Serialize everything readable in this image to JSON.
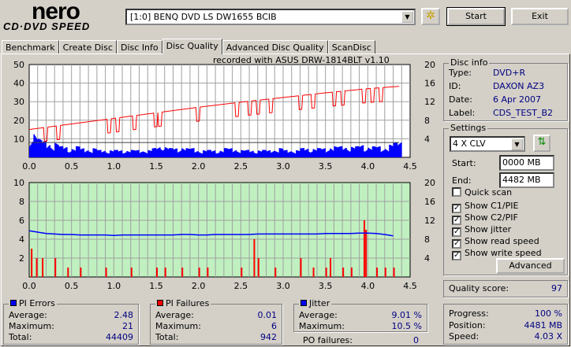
{
  "app": {
    "logo_top": "nero",
    "logo_bottom": "CD·DVD SPEED"
  },
  "toolbar": {
    "drive": "[1:0]  BENQ DVD LS DW1655 BCIB",
    "start": "Start",
    "exit": "Exit"
  },
  "tabs": [
    "Benchmark",
    "Create Disc",
    "Disc Info",
    "Disc Quality",
    "Advanced Disc Quality",
    "ScanDisc"
  ],
  "recorded_with": "recorded with ASUS    DRW-1814BLT      v1.10",
  "disc_info": {
    "title": "Disc info",
    "type_label": "Type:",
    "type": "DVD+R",
    "id_label": "ID:",
    "id": "DAXON AZ3",
    "date_label": "Date:",
    "date": "6 Apr 2007",
    "label_label": "Label:",
    "label": "CDS_TEST_B2"
  },
  "settings": {
    "title": "Settings",
    "speed": "4 X CLV",
    "start_label": "Start:",
    "start": "0000 MB",
    "end_label": "End:",
    "end": "4482 MB",
    "quick_scan": "Quick scan",
    "show_c1": "Show C1/PIE",
    "show_c2": "Show C2/PIF",
    "show_jitter": "Show jitter",
    "show_read": "Show read speed",
    "show_write": "Show write speed",
    "advanced": "Advanced"
  },
  "quality": {
    "label": "Quality score:",
    "value": "97"
  },
  "progress": {
    "progress_label": "Progress:",
    "progress": "100 %",
    "position_label": "Position:",
    "position": "4481 MB",
    "speed_label": "Speed:",
    "speed": "4.03 X"
  },
  "pi_errors": {
    "title": "PI Errors",
    "avg_label": "Average:",
    "avg": "2.48",
    "max_label": "Maximum:",
    "max": "21",
    "total_label": "Total:",
    "total": "44409"
  },
  "pi_failures": {
    "title": "PI Failures",
    "avg_label": "Average:",
    "avg": "0.01",
    "max_label": "Maximum:",
    "max": "6",
    "total_label": "Total:",
    "total": "942"
  },
  "jitter": {
    "title": "Jitter",
    "avg_label": "Average:",
    "avg": "9.01 %",
    "max_label": "Maximum:",
    "max": "10.5 %",
    "po_label": "PO failures:",
    "po": "0"
  },
  "colors": {
    "pie": "#0000ff",
    "pif": "#ff0000",
    "speed": "#ff0000",
    "jitter": "#0000ff",
    "green": "#c0f0c0"
  },
  "chart_data": [
    {
      "type": "bar",
      "title": "PI Errors / Read speed",
      "xlim": [
        0,
        4.5
      ],
      "ylim": [
        0,
        50
      ],
      "y2lim": [
        0,
        20
      ],
      "x_ticks": [
        "0.0",
        "0.5",
        "1.0",
        "1.5",
        "2.0",
        "2.5",
        "3.0",
        "3.5",
        "4.0",
        "4.5"
      ],
      "y_ticks": [
        "10",
        "20",
        "30",
        "40",
        "50"
      ],
      "y2_ticks": [
        "4",
        "8",
        "12",
        "16",
        "20"
      ],
      "pie_step": 0.05,
      "pie": [
        12,
        15,
        10,
        9,
        8,
        7,
        8,
        6,
        6,
        5,
        5,
        6,
        5,
        5,
        4,
        5,
        4,
        4,
        4,
        4,
        4,
        4,
        4,
        4,
        4,
        4,
        4,
        4,
        4,
        5,
        6,
        7,
        6,
        5,
        5,
        5,
        6,
        5,
        5,
        4,
        4,
        4,
        4,
        4,
        4,
        4,
        5,
        5,
        5,
        4,
        4,
        4,
        4,
        4,
        4,
        4,
        4,
        5,
        4,
        5,
        4,
        4,
        4,
        4,
        5,
        5,
        5,
        5,
        5,
        5,
        5,
        6,
        6,
        6,
        6,
        6,
        6,
        6,
        7,
        6,
        6,
        6,
        6,
        5,
        6,
        7,
        8,
        9
      ],
      "speed_x": [
        0,
        0.5,
        1,
        1.5,
        2,
        2.5,
        3,
        3.5,
        4,
        4.37
      ],
      "speed": [
        6,
        7.2,
        8.4,
        9.6,
        10.8,
        11.9,
        12.9,
        13.9,
        14.8,
        15.3
      ],
      "speed_dips": [
        0.2,
        0.35,
        0.95,
        1.05,
        1.25,
        1.5,
        1.55,
        2.0,
        2.45,
        2.6,
        2.7,
        2.85,
        3.2,
        3.35,
        3.6,
        3.7,
        3.95,
        4.05,
        4.15
      ]
    },
    {
      "type": "bar",
      "title": "PI Failures / Jitter",
      "xlim": [
        0,
        4.5
      ],
      "ylim": [
        0,
        10
      ],
      "y2lim": [
        0,
        20
      ],
      "x_ticks": [
        "0.0",
        "0.5",
        "1.0",
        "1.5",
        "2.0",
        "2.5",
        "3.0",
        "3.5",
        "4.0",
        "4.5"
      ],
      "y_ticks": [
        "2",
        "4",
        "6",
        "8",
        "10"
      ],
      "y2_ticks": [
        "4",
        "8",
        "12",
        "16",
        "20"
      ],
      "pif": [
        [
          0.02,
          3
        ],
        [
          0.08,
          2
        ],
        [
          0.15,
          2
        ],
        [
          0.3,
          2
        ],
        [
          0.45,
          1
        ],
        [
          0.6,
          1
        ],
        [
          0.9,
          1
        ],
        [
          1.2,
          1
        ],
        [
          1.5,
          1
        ],
        [
          1.6,
          1
        ],
        [
          1.8,
          1
        ],
        [
          2.0,
          1
        ],
        [
          2.1,
          1
        ],
        [
          2.5,
          1
        ],
        [
          2.65,
          4
        ],
        [
          2.7,
          2
        ],
        [
          2.9,
          1
        ],
        [
          3.2,
          2
        ],
        [
          3.35,
          1
        ],
        [
          3.5,
          1
        ],
        [
          3.55,
          2
        ],
        [
          3.7,
          1
        ],
        [
          3.8,
          1
        ],
        [
          3.95,
          6
        ],
        [
          3.97,
          5
        ],
        [
          4.1,
          1
        ],
        [
          4.2,
          1
        ],
        [
          4.3,
          1
        ]
      ],
      "jitter_step": 0.1,
      "jitter": [
        9.8,
        9.5,
        9.2,
        9.1,
        9.0,
        9.0,
        8.9,
        8.9,
        8.9,
        8.9,
        8.8,
        8.9,
        8.9,
        8.9,
        8.9,
        8.9,
        8.9,
        8.9,
        9.0,
        9.0,
        8.9,
        8.9,
        9.0,
        9.0,
        9.0,
        9.0,
        9.0,
        9.1,
        9.1,
        9.1,
        9.1,
        9.1,
        9.1,
        9.1,
        9.1,
        9.2,
        9.2,
        9.2,
        9.2,
        9.3,
        9.3,
        9.2,
        9.0,
        8.7
      ]
    }
  ]
}
